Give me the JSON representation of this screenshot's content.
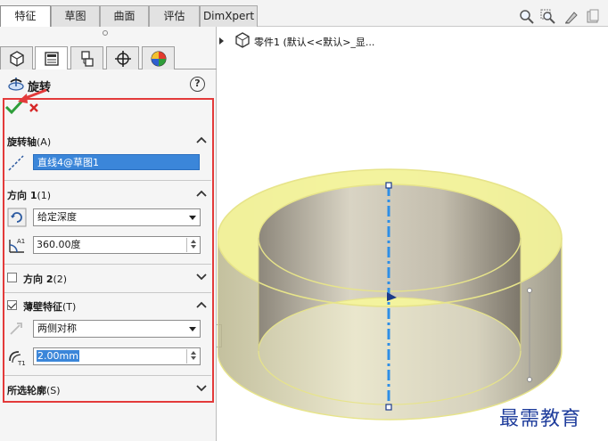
{
  "tabs": [
    {
      "label": "特征",
      "active": true
    },
    {
      "label": "草图",
      "active": false
    },
    {
      "label": "曲面",
      "active": false
    },
    {
      "label": "评估",
      "active": false
    },
    {
      "label": "DimXpert",
      "active": false
    }
  ],
  "view_toolbar": {
    "icons": [
      "zoom-to-fit-icon",
      "zoom-to-area-icon",
      "previous-view-icon",
      "section-view-icon"
    ]
  },
  "panel_tabs": [
    "feature-manager-icon",
    "property-manager-icon",
    "configuration-manager-icon",
    "dimxpert-manager-icon",
    "display-manager-icon"
  ],
  "feature": {
    "title": "旋转",
    "help": "?"
  },
  "axis_section": {
    "header": "旋转轴",
    "suffix": "(A)",
    "selected_entity": "直线4@草图1"
  },
  "direction1": {
    "header": "方向 1",
    "suffix": "(1)",
    "end_condition": "给定深度",
    "angle": "360.00度"
  },
  "direction2": {
    "header": "方向 2",
    "suffix": "(2)",
    "checked": false
  },
  "thin_feature": {
    "header": "薄壁特征",
    "suffix": "(T)",
    "checked": true,
    "type": "两侧对称",
    "thickness": "2.00mm"
  },
  "selected_contours": {
    "header": "所选轮廓",
    "suffix": "(S)"
  },
  "tree": {
    "text": "零件1  (默认<<默认>_显..."
  },
  "watermark": "最需教育",
  "colors": {
    "highlight": "#3b86d9",
    "callout_border": "#e33a3a",
    "preview_yellow": "#f4f49a",
    "axis_blue": "#2f8fe6"
  }
}
